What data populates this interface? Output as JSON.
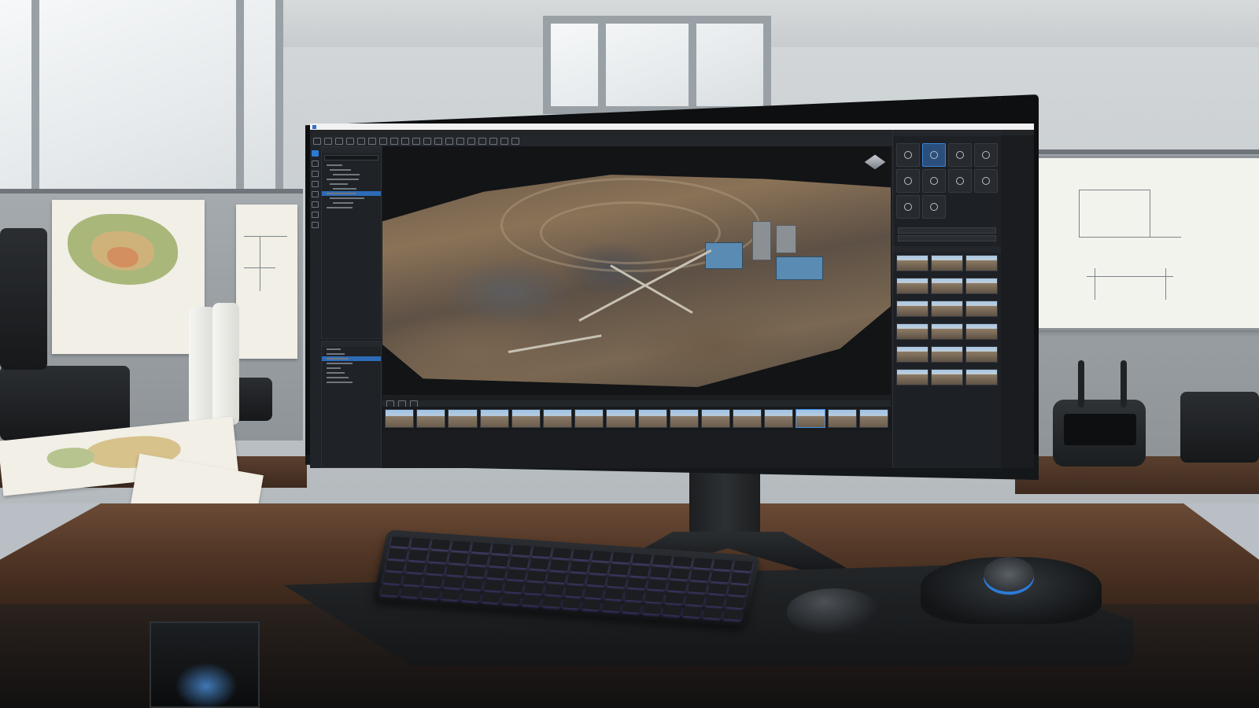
{
  "app": {
    "title": "",
    "menu": [],
    "corner_text": ""
  },
  "left_panel": {
    "title": "",
    "search_placeholder": "",
    "tree": []
  },
  "project_panel": {
    "title": "",
    "tree": []
  },
  "viewport": {
    "status": []
  },
  "right_panel": {
    "head": "",
    "section_tools": "",
    "tools": [],
    "section_export": "",
    "buttons": [],
    "photos_head": "",
    "photos": []
  },
  "colors": {
    "accent": "#2d79d6",
    "desk": "#4e3424",
    "wall": "#c5cacd"
  },
  "icons": [
    "app-icon",
    "nav-cube-icon",
    "window-close-icon",
    "window-maximize-icon",
    "window-minimize-icon"
  ]
}
